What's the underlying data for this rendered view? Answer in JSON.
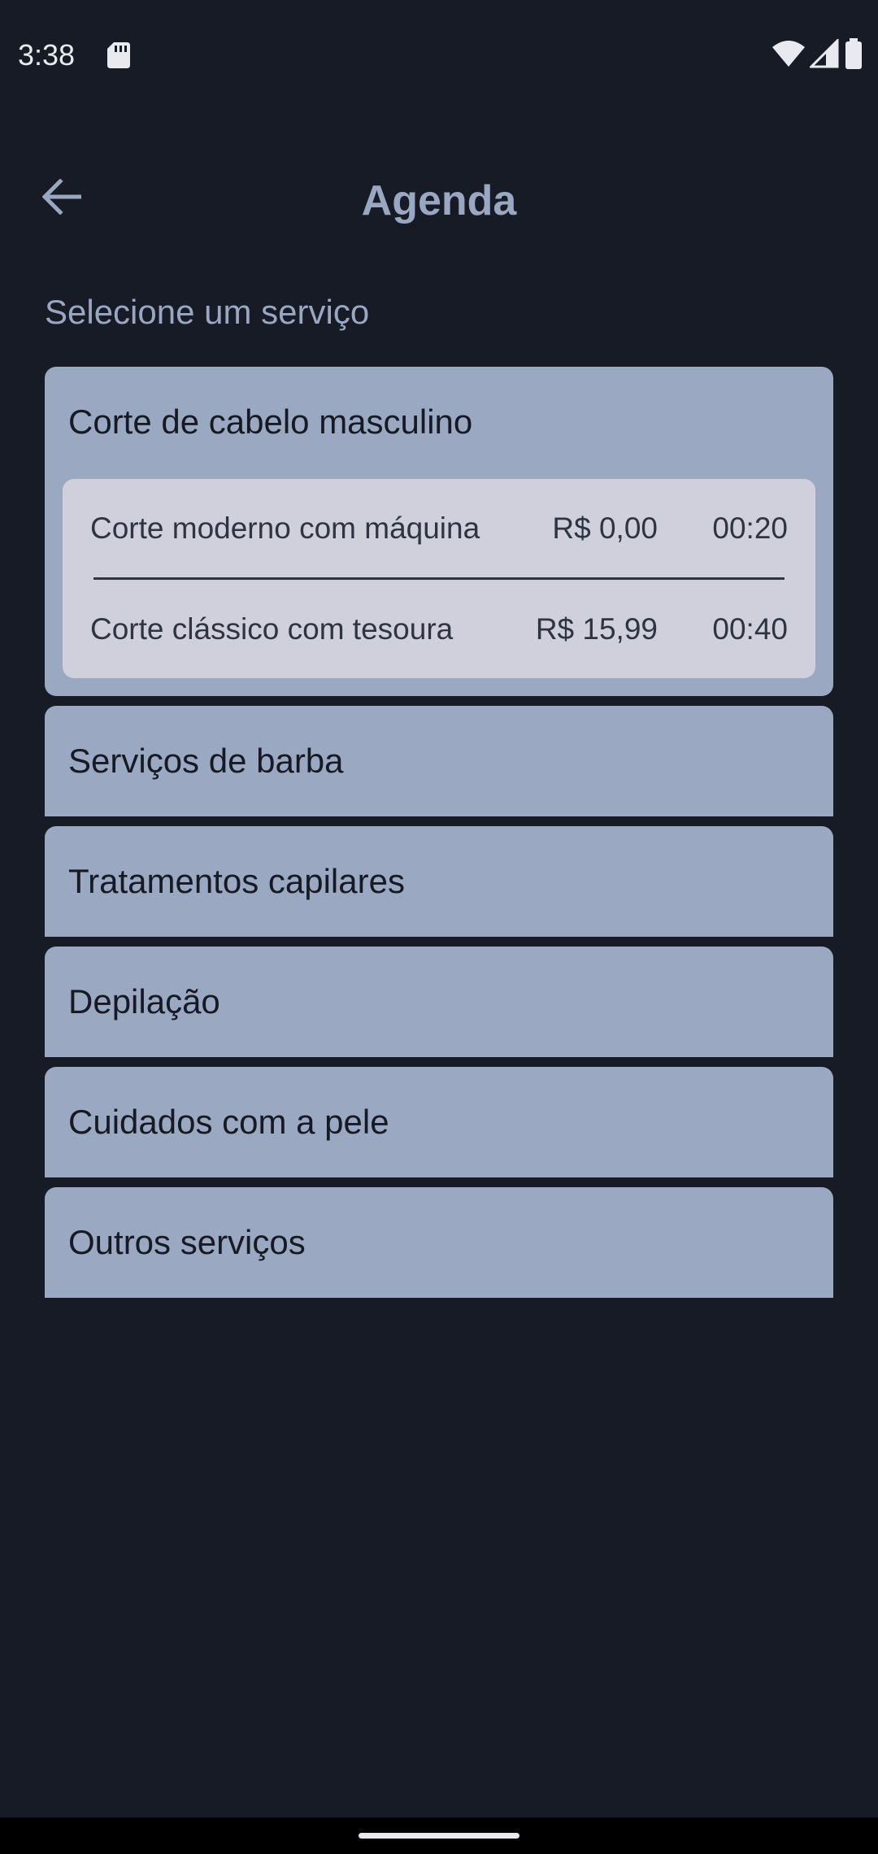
{
  "status_bar": {
    "time": "3:38",
    "icons": [
      "sd-card-icon",
      "wifi-icon",
      "signal-icon",
      "battery-icon"
    ]
  },
  "header": {
    "title": "Agenda",
    "back_icon": "arrow-left-icon"
  },
  "subtitle": "Selecione um serviço",
  "colors": {
    "background": "#161b25",
    "card": "#9ba8c2",
    "subcard": "#d0d0dc",
    "title": "#9aa7c1"
  },
  "categories": [
    {
      "label": "Corte de cabelo masculino",
      "expanded": true,
      "services": [
        {
          "name": "Corte moderno com máquina",
          "price": "R$ 0,00",
          "duration": "00:20"
        },
        {
          "name": "Corte clássico com tesoura",
          "price": "R$ 15,99",
          "duration": "00:40"
        }
      ]
    },
    {
      "label": "Serviços de barba",
      "expanded": false
    },
    {
      "label": "Tratamentos capilares",
      "expanded": false
    },
    {
      "label": "Depilação",
      "expanded": false
    },
    {
      "label": "Cuidados com a pele",
      "expanded": false
    },
    {
      "label": "Outros serviços",
      "expanded": false
    }
  ]
}
